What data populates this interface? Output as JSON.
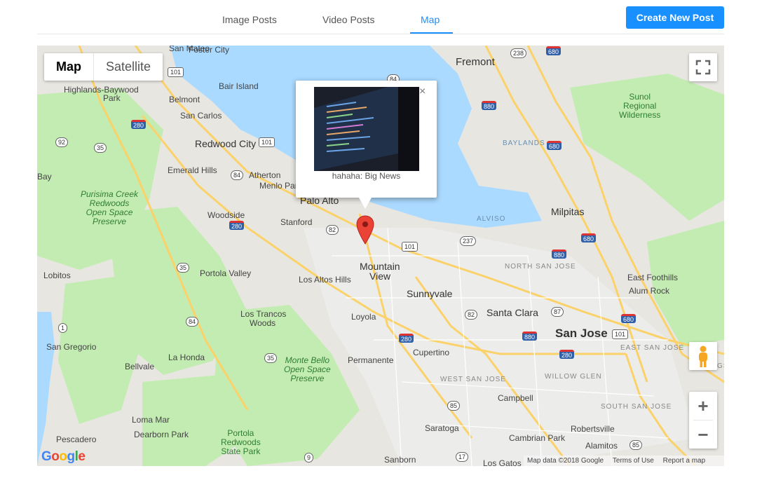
{
  "tabs": [
    {
      "label": "Image Posts",
      "active": false
    },
    {
      "label": "Video Posts",
      "active": false
    },
    {
      "label": "Map",
      "active": true
    }
  ],
  "actions": {
    "create_label": "Create New Post"
  },
  "map_controls": {
    "map_type_options": [
      "Map",
      "Satellite"
    ],
    "selected_map_type": "Map",
    "fullscreen_icon": "fullscreen-icon",
    "pegman_icon": "pegman-icon",
    "zoom_in": "+",
    "zoom_out": "−"
  },
  "info_window": {
    "caption": "hahaha: Big News",
    "close_symbol": "×"
  },
  "map_labels": {
    "fremont": "Fremont",
    "foster_city": "Foster City",
    "san_mateo": "San Mateo",
    "highlands": "Highlands-Baywood",
    "highlands2": "Park",
    "belmont": "Belmont",
    "bair_island": "Bair Island",
    "san_carlos": "San Carlos",
    "redwood_city": "Redwood City",
    "emerald_hills": "Emerald Hills",
    "atherton": "Atherton",
    "menlo_park": "Menlo Par",
    "palo_alto": "Palo Alto",
    "woodside": "Woodside",
    "stanford": "Stanford",
    "portola_valley": "Portola Valley",
    "los_altos_hills": "Los Altos Hills",
    "mountain_view_1": "Mountain",
    "mountain_view_2": "View",
    "sunnyvale": "Sunnyvale",
    "santa_clara": "Santa Clara",
    "san_jose": "San Jose",
    "milpitas": "Milpitas",
    "east_foothills": "East Foothills",
    "alum_rock": "Alum Rock",
    "lobitos": "Lobitos",
    "los_trancos_1": "Los Trancos",
    "los_trancos_2": "Woods",
    "loyola": "Loyola",
    "cupertino": "Cupertino",
    "san_gregorio": "San Gregorio",
    "bellvale": "Bellvale",
    "la_honda": "La Honda",
    "permanente": "Permanente",
    "campbell": "Campbell",
    "loma_mar": "Loma Mar",
    "pescadero": "Pescadero",
    "dearborn_park": "Dearborn Park",
    "saratoga": "Saratoga",
    "cambrian_park": "Cambrian Park",
    "robertsville": "Robertsville",
    "alamitos": "Alamitos",
    "los_gatos": "Los Gatos",
    "sanborn": "Sanborn",
    "bay": "Bay",
    "purisima": "Purisima Creek",
    "purisima2": "Redwoods",
    "purisima3": "Open Space",
    "purisima4": "Preserve",
    "monte_bello": "Monte Bello",
    "monte_bello2": "Open Space",
    "monte_bello3": "Preserve",
    "portola_redwoods": "Portola",
    "portola_redwoods2": "Redwoods",
    "portola_redwoods3": "State Park",
    "sunol": "Sunol",
    "sunol2": "Regional",
    "sunol3": "Wilderness",
    "baylands": "BAYLANDS",
    "alviso": "ALVISO",
    "north_san_jose": "NORTH SAN JOSE",
    "east_san_jose": "EAST SAN JOSE",
    "west_san_jose": "WEST SAN JOSE",
    "willow_glen": "WILLOW GLEN",
    "south_san_jose": "SOUTH SAN JOSE",
    "gs": "GS"
  },
  "shields": {
    "i280a": "280",
    "i280b": "280",
    "i280c": "280",
    "i280d": "280",
    "i880a": "880",
    "i880b": "880",
    "i880c": "880",
    "i880d": "880",
    "i680a": "680",
    "i680b": "680",
    "i680c": "680",
    "i680d": "680",
    "us101a": "101",
    "us101b": "101",
    "us101c": "101",
    "us101d": "101",
    "s238": "238",
    "s84a": "84",
    "s84b": "84",
    "s84c": "84",
    "s92": "92",
    "s35a": "35",
    "s35b": "35",
    "s35c": "35",
    "s82a": "82",
    "s82b": "82",
    "s237": "237",
    "s87": "87",
    "s85a": "85",
    "s85b": "85",
    "s1": "1",
    "s9": "9",
    "s17": "17"
  },
  "attribution": {
    "google": "Google",
    "map_data": "Map data ©2018 Google",
    "terms": "Terms of Use",
    "report": "Report a map error"
  },
  "colors": {
    "accent": "#1890ff",
    "marker": "#ea4335",
    "water": "#aadaff",
    "park": "#c3ecb2",
    "highway": "#fbd26a"
  }
}
